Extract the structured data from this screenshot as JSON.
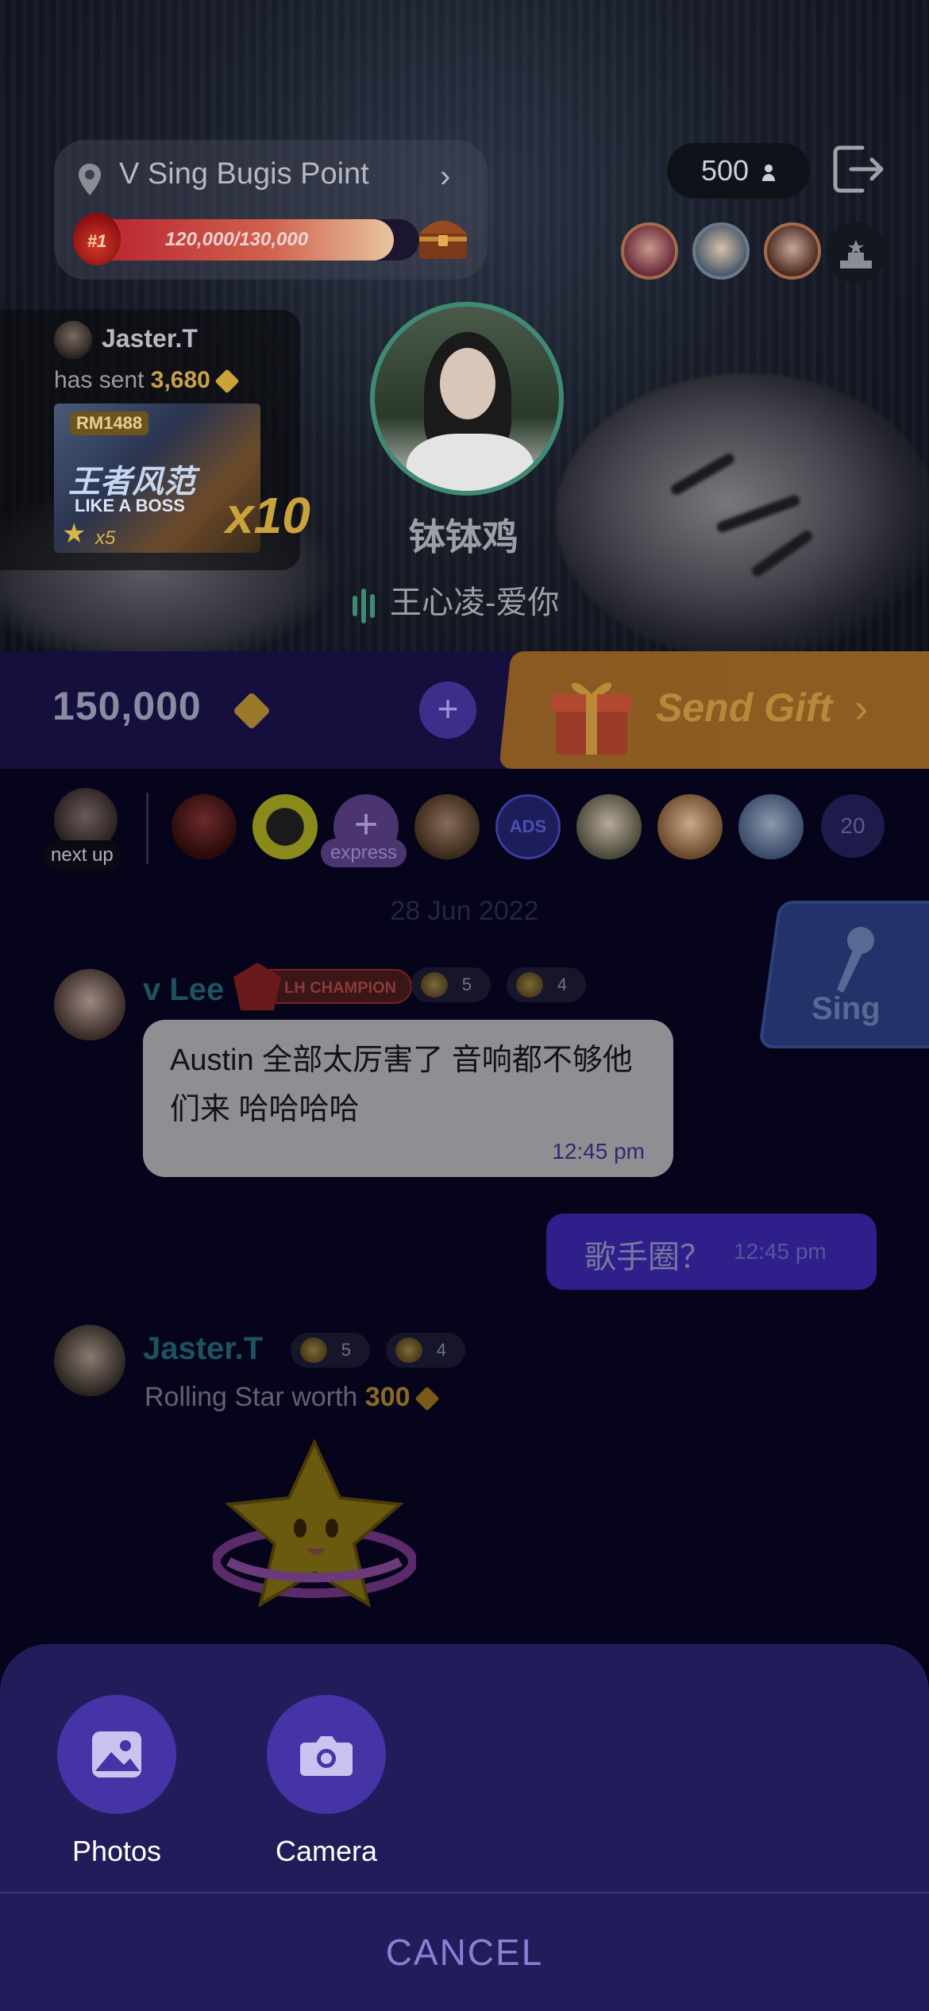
{
  "room": {
    "venue_name": "V Sing Bugis Point",
    "rank": "#1",
    "progress_text": "120,000/130,000",
    "progress_fraction": 0.923,
    "listener_count": "500",
    "singer_name": "钵钵鸡",
    "song_title": "王心凌-爱你"
  },
  "gift_notification": {
    "sender": "Jaster.T",
    "sent_prefix": "has sent",
    "amount": "3,680",
    "gift_tag": "RM1488",
    "gift_title_cn": "王者风范",
    "gift_title_en": "LIKE A BOSS",
    "gift_star_count": "x5",
    "multiplier": "x10"
  },
  "gift_bar": {
    "balance": "150,000",
    "add_label": "+",
    "send_gift_label": "Send Gift",
    "chevron": "›"
  },
  "queue": {
    "next_up_label": "next up",
    "express_plus": "+",
    "express_label": "express",
    "ads_label": "ADS",
    "count": "20"
  },
  "chat": {
    "date": "28 Jun 2022",
    "sing_label": "Sing",
    "messages": [
      {
        "user": "v Lee",
        "champion_badge": "LH CHAMPION",
        "level_a": "5",
        "level_b": "4",
        "text": "Austin 全部太厉害了 音响都不够他们来 哈哈哈哈",
        "time": "12:45 pm"
      },
      {
        "text": "歌手圈？",
        "time": "12:45 pm"
      },
      {
        "user": "Jaster.T",
        "level_a": "5",
        "level_b": "4",
        "gift_prefix": "Rolling Star worth",
        "gift_amount": "300"
      }
    ]
  },
  "sheet": {
    "photos_label": "Photos",
    "camera_label": "Camera",
    "cancel_label": "CANCEL"
  },
  "colors": {
    "accent_purple": "#4434a6",
    "sheet_bg": "#231c5b",
    "gift_gold": "#c9a23a",
    "progress_red": "#b81e2c"
  },
  "icons": [
    "location-pin-icon",
    "chevron-right-icon",
    "treasure-chest-icon",
    "person-icon",
    "exit-icon",
    "podium-icon",
    "diamond-icon",
    "gift-box-icon",
    "plus-icon",
    "microphone-icon",
    "equalizer-icon",
    "photo-icon",
    "camera-icon"
  ]
}
